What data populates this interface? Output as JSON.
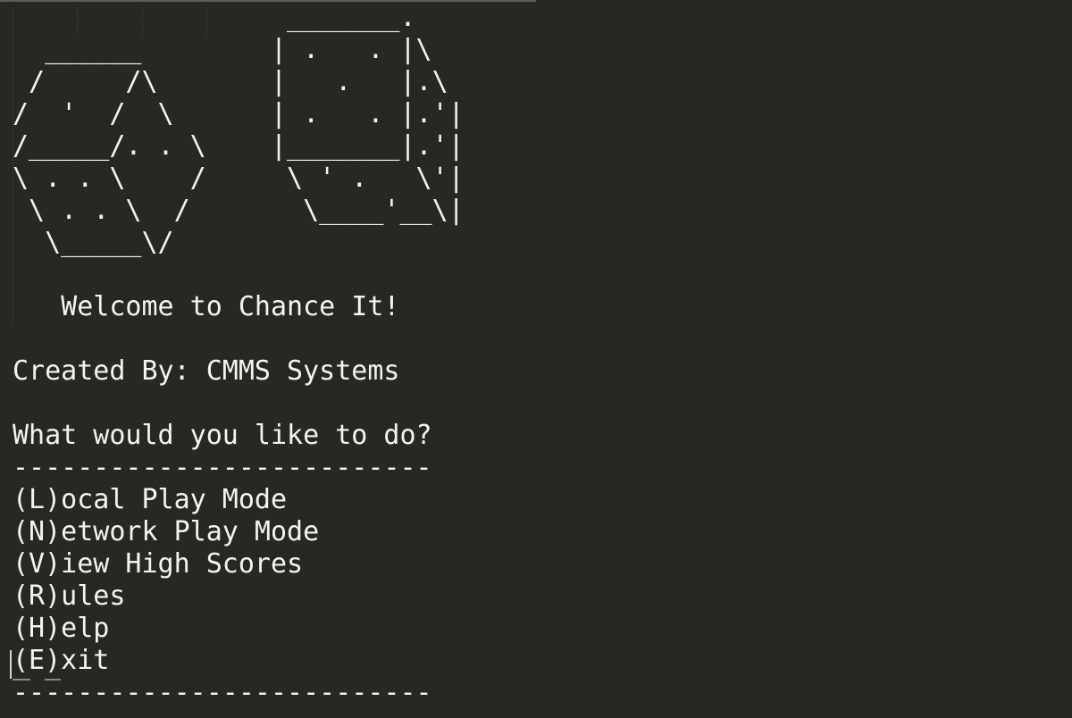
{
  "screen": {
    "ascii_art": [
      "                 _______.",
      "  ______        | .   . |\\",
      " /     /\\       |   .   |.\\",
      "/  '  /  \\      | .   . |.'|",
      "/_____/. . \\    |_______|.'|",
      "\\ . . \\    /     \\ ' .   \\'|",
      " \\ . . \\  /       \\____'__\\|",
      "  \\_____\\/",
      ""
    ],
    "welcome": "   Welcome to Chance It!",
    "blank_1": "",
    "created_by": "Created By: CMMS Systems",
    "blank_2": "",
    "prompt": "What would you like to do?",
    "separator_top": "--------------------------",
    "menu": [
      "(L)ocal Play Mode",
      "(N)etwork Play Mode",
      "(V)iew High Scores",
      "(R)ules",
      "(H)elp",
      "(E)xit"
    ],
    "separator_bottom": "--------------------------"
  }
}
